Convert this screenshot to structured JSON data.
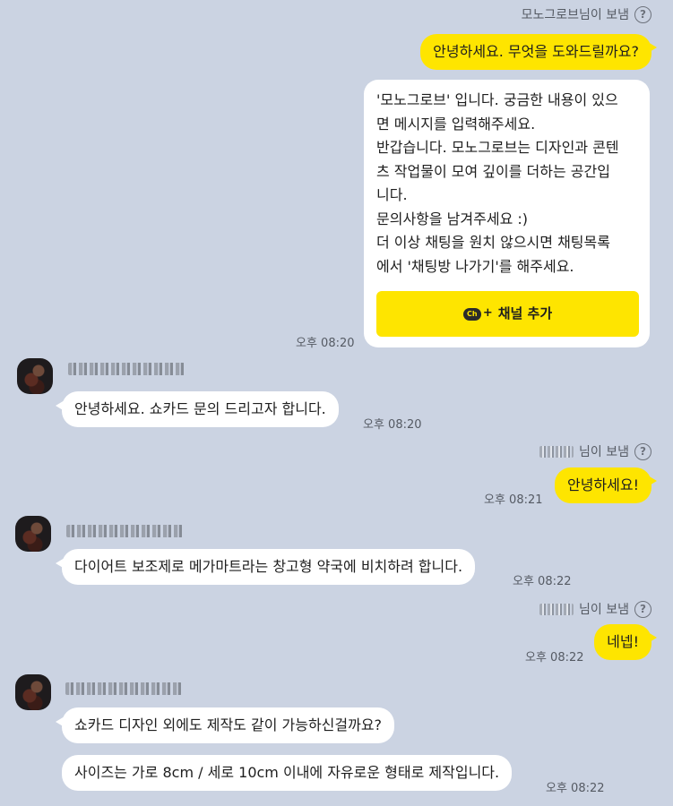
{
  "sender_suffix": "님이 보냄",
  "help_glyph": "?",
  "channel": {
    "label": "모노그로브님이 보냄",
    "greeting": "안녕하세요. 무엇을 도와드릴까요?",
    "card_lines": [
      "'모노그로브' 입니다. 궁금한 내용이 있으",
      "면 메시지를 입력해주세요.",
      "반갑습니다. 모노그로브는 디자인과 콘텐",
      "츠 작업물이 모여 깊이를 더하는 공간입",
      "니다.",
      "문의사항을 남겨주세요 :)",
      "더 이상 채팅을 원치 않으시면 채팅목록",
      "에서 '채팅방 나가기'를 해주세요."
    ],
    "channel_button": "채널 추가",
    "channel_icon_text": "Ch",
    "time": "오후 08:20"
  },
  "user_msg_1": {
    "text": "안녕하세요. 쇼카드 문의 드리고자 합니다.",
    "time": "오후 08:20"
  },
  "reply_1": {
    "text": "안녕하세요!",
    "time": "오후 08:21"
  },
  "user_msg_2": {
    "text": "다이어트 보조제로 메가마트라는 창고형 약국에 비치하려 합니다.",
    "time": "오후 08:22"
  },
  "reply_2": {
    "text": "네넵!",
    "time": "오후 08:22"
  },
  "user_msg_3a": {
    "text": "쇼카드 디자인 외에도 제작도 같이 가능하신걸까요?"
  },
  "user_msg_3b": {
    "text": "사이즈는 가로 8cm / 세로 10cm 이내에 자유로운 형태로 제작입니다.",
    "time": "오후 08:22"
  },
  "colors": {
    "background": "#cbd3e2",
    "bubble_yellow": "#fee500",
    "bubble_white": "#ffffff"
  }
}
